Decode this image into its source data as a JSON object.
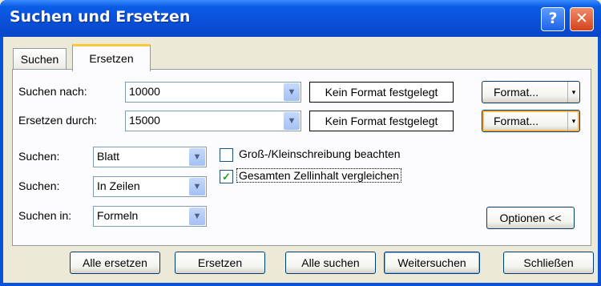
{
  "window": {
    "title": "Suchen und Ersetzen"
  },
  "tabs": [
    {
      "label": "Suchen"
    },
    {
      "label": "Ersetzen"
    }
  ],
  "search_for": {
    "label": "Suchen nach:",
    "value": "10000",
    "format": "Kein Format festgelegt",
    "format_button": "Format..."
  },
  "replace_with": {
    "label": "Ersetzen durch:",
    "value": "15000",
    "format": "Kein Format festgelegt",
    "format_button": "Format..."
  },
  "options": {
    "within": {
      "label": "Suchen:",
      "value": "Blatt"
    },
    "search": {
      "label": "Suchen:",
      "value": "In Zeilen"
    },
    "look_in": {
      "label": "Suchen in:",
      "value": "Formeln"
    },
    "match_case": {
      "label": "Groß-/Kleinschreibung beachten",
      "checked": false
    },
    "match_entire": {
      "label": "Gesamten Zellinhalt vergleichen",
      "checked": true
    },
    "options_button": "Optionen <<"
  },
  "buttons": {
    "replace_all": "Alle ersetzen",
    "replace": "Ersetzen",
    "find_all": "Alle suchen",
    "find_next": "Weitersuchen",
    "close": "Schließen"
  },
  "icons": {
    "help": "?",
    "close": "✕",
    "dropdown": "▼",
    "check": "✓",
    "split": "▾"
  }
}
